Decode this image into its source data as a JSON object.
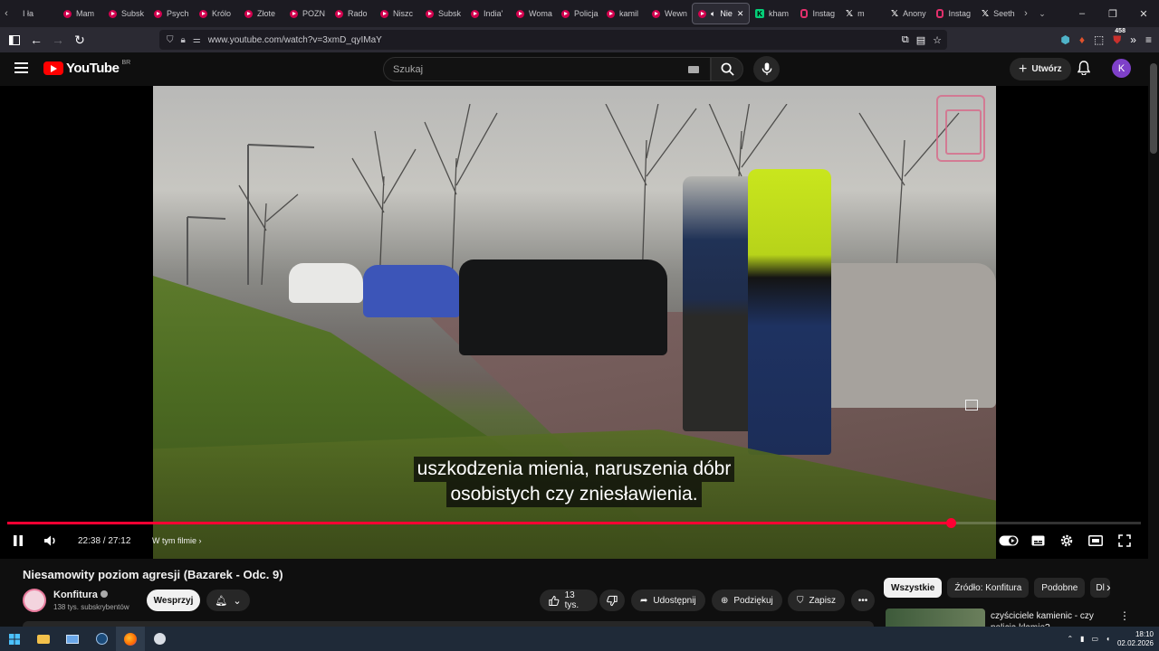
{
  "browser": {
    "tabs": [
      {
        "label": "I ła",
        "type": "plain"
      },
      {
        "label": "Mam",
        "type": "yt"
      },
      {
        "label": "Subsk",
        "type": "yt"
      },
      {
        "label": "Psych",
        "type": "yt"
      },
      {
        "label": "Królo",
        "type": "yt"
      },
      {
        "label": "Złote",
        "type": "yt"
      },
      {
        "label": "POZN",
        "type": "yt"
      },
      {
        "label": "Rado",
        "type": "yt"
      },
      {
        "label": "Niszc",
        "type": "yt"
      },
      {
        "label": "Subsk",
        "type": "yt"
      },
      {
        "label": "India'",
        "type": "yt"
      },
      {
        "label": "Woma",
        "type": "yt"
      },
      {
        "label": "Policja",
        "type": "yt"
      },
      {
        "label": "kamil",
        "type": "yt"
      },
      {
        "label": "Wewn",
        "type": "yt"
      },
      {
        "label": "Nie",
        "type": "yt-active"
      },
      {
        "label": "kham",
        "type": "kick"
      },
      {
        "label": "Instag",
        "type": "ig"
      },
      {
        "label": "m",
        "type": "x"
      },
      {
        "label": "Anony",
        "type": "x"
      },
      {
        "label": "Instag",
        "type": "ig"
      },
      {
        "label": "Seeth",
        "type": "x"
      }
    ],
    "url": "www.youtube.com/watch?v=3xmD_qyIMaY",
    "extension_badge": "458"
  },
  "youtube": {
    "logo_text": "YouTube",
    "country_code": "BR",
    "search_placeholder": "Szukaj",
    "create_label": "Utwórz",
    "avatar_letter": "K"
  },
  "player": {
    "subtitle_line1": "uszkodzenia mienia, naruszenia dóbr",
    "subtitle_line2": "osobistych czy zniesławienia.",
    "time_current": "22:38",
    "time_separator": " / ",
    "time_total": "27:12",
    "progress_fraction": 0.832,
    "chapter_label": "W tym filmie"
  },
  "video": {
    "title": "Niesamowity poziom agresji (Bazarek - Odc. 9)",
    "channel_name": "Konfitura",
    "subscribers": "138 tys. subskrybentów",
    "support_label": "Wesprzyj",
    "likes": "13 tys.",
    "share_label": "Udostępnij",
    "thanks_label": "Podziękuj",
    "save_label": "Zapisz"
  },
  "sidebar": {
    "chips": [
      {
        "label": "Wszystkie",
        "active": true
      },
      {
        "label": "Źródło: Konfitura",
        "active": false
      },
      {
        "label": "Podobne",
        "active": false
      },
      {
        "label": "Dl",
        "active": false
      }
    ],
    "reco_title": "czyściciele kamienic - czy policja kłamie?"
  },
  "taskbar": {
    "time": "18:10",
    "date": "02.02.2026"
  }
}
